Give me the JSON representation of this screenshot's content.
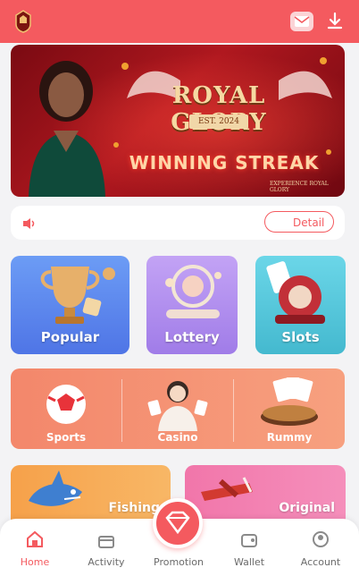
{
  "header": {
    "logo": "crest-logo",
    "icons": [
      "mail-icon",
      "download-icon"
    ],
    "accent": "#f45a5f"
  },
  "banner": {
    "title": "ROYAL GLORY",
    "est": "EST. 2024",
    "subtitle": "WINNING STREAK",
    "footer": "EXPERIENCE ROYAL GLORY"
  },
  "notice": {
    "icon": "speaker-icon",
    "detail_label": "Detail"
  },
  "categories": [
    {
      "label": "Popular",
      "icon": "trophy-icon",
      "color": "#5f8cf0"
    },
    {
      "label": "Lottery",
      "icon": "lottery-drum-icon",
      "color": "#b18af0"
    },
    {
      "label": "Slots",
      "icon": "slot-machine-icon",
      "color": "#4fc3d8"
    }
  ],
  "strip": [
    {
      "label": "Sports",
      "icon": "soccer-ball-icon"
    },
    {
      "label": "Casino",
      "icon": "dealer-icon"
    },
    {
      "label": "Rummy",
      "icon": "cards-icon"
    }
  ],
  "bigcards": [
    {
      "label": "Fishing",
      "icon": "shark-icon",
      "color": "#f7a54a"
    },
    {
      "label": "Original",
      "icon": "plane-icon",
      "color": "#f06aa1"
    }
  ],
  "tabs": [
    {
      "label": "Home",
      "icon": "home-icon",
      "active": true
    },
    {
      "label": "Activity",
      "icon": "gift-icon",
      "active": false
    },
    {
      "label": "Promotion",
      "icon": "diamond-icon",
      "active": false
    },
    {
      "label": "Wallet",
      "icon": "wallet-icon",
      "active": false
    },
    {
      "label": "Account",
      "icon": "account-icon",
      "active": false
    }
  ]
}
